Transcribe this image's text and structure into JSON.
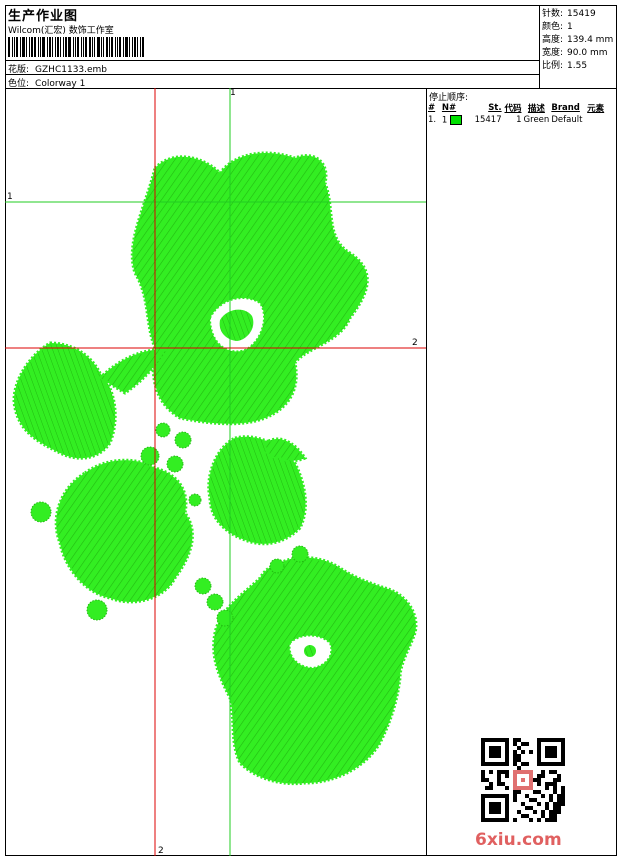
{
  "header": {
    "title": "生产作业图",
    "subtitle": "Wilcom(汇宏) 数饰工作室",
    "pattern_label": "花版:",
    "pattern_value": "GZHC1133.emb",
    "colorway_label": "色位:",
    "colorway_value": "Colorway 1"
  },
  "stats": [
    {
      "label": "针数:",
      "value": "15419"
    },
    {
      "label": "颜色:",
      "value": "1"
    },
    {
      "label": "高度:",
      "value": "139.4 mm"
    },
    {
      "label": "宽度:",
      "value": "90.0 mm"
    },
    {
      "label": "比例:",
      "value": "1.55"
    }
  ],
  "guides": {
    "vertical_green": "1",
    "horizontal_green": "1",
    "horizontal_red": "2",
    "vertical_red": "2"
  },
  "stop_sequence": {
    "title": "停止顺序:",
    "columns": [
      "#",
      "N#",
      "St.",
      "代码",
      "描述",
      "Brand",
      "元素"
    ],
    "rows": [
      {
        "num": "1.",
        "needle": "1",
        "stitches": "15417",
        "code": "1",
        "description": "Green",
        "brand": "Default",
        "color": "#00e000"
      }
    ]
  },
  "watermark": "6xiu.com",
  "colors": {
    "thread": "#33ee22",
    "thread_dark": "#22aa11",
    "guide_green": "#22cc22",
    "guide_red": "#dd0000"
  }
}
